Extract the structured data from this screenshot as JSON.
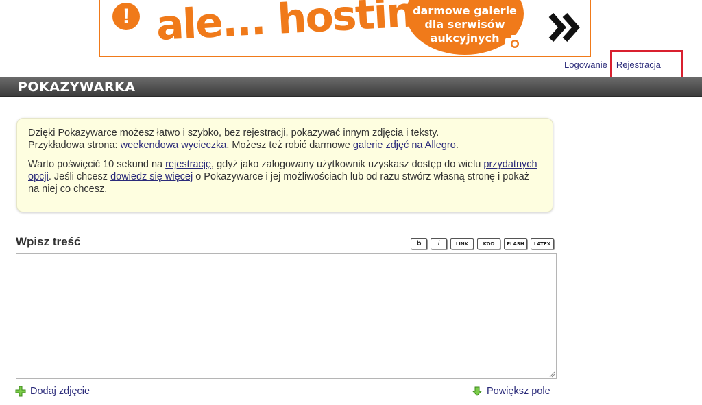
{
  "banner": {
    "brand": "ale... hosting!",
    "alert_glyph": "!",
    "tagline": [
      "darmowe galerie",
      "dla serwisów",
      "aukcyjnych"
    ],
    "icons": [
      "exclamation-icon",
      "camera-icon",
      "double-chevron-right-icon"
    ],
    "accent_color": "#f07a1a"
  },
  "toplinks": {
    "login": "Logowanie",
    "register": "Rejestracja"
  },
  "header": {
    "title": "POKAZYWARKA"
  },
  "info": {
    "p1_text1": "Dzięki Pokazywarce możesz łatwo i szybko, bez rejestracji, pokazywać innym zdjęcia i teksty.",
    "p1_text2": "Przykładowa strona: ",
    "p1_link1": "weekendowa wycieczka",
    "p1_text3": ". Możesz też robić darmowe ",
    "p1_link2": "galerie zdjęć na Allegro",
    "p1_text4": ".",
    "p2_text1": "Warto poświęcić 10 sekund na ",
    "p2_link1": "rejestrację",
    "p2_text2": ", gdyż jako zalogowany użytkownik uzyskasz dostęp do wielu ",
    "p2_link2": "przydatnych opcji",
    "p2_text3": ". Jeśli chcesz ",
    "p2_link3": "dowiedz się więcej",
    "p2_text4": " o Pokazywarce i jej możliwościach lub od razu stwórz własną stronę i pokaż na niej co chcesz."
  },
  "editor": {
    "title": "Wpisz treść",
    "value": "",
    "toolbar": {
      "bold": "b",
      "italic": "i",
      "link": "LINK",
      "code": "KOD",
      "flash": "FLASH",
      "latex": "LATEX"
    }
  },
  "bottom": {
    "add_photo": "Dodaj zdjęcie",
    "enlarge": "Powiększ pole",
    "icons": [
      "plus-icon",
      "arrow-down-icon"
    ],
    "plus_color": "#5cb82e",
    "arrow_color": "#5cb82e"
  },
  "colors": {
    "link": "#2b2b7a",
    "highlight": "#d9202f",
    "info_bg": "#fefee0"
  }
}
